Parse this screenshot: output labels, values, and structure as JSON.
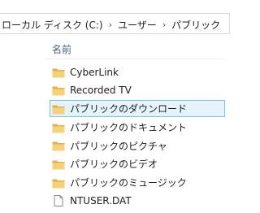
{
  "address_bar": {
    "crumbs": [
      {
        "label": "ローカル ディスク (C:)"
      },
      {
        "label": "ユーザー"
      },
      {
        "label": "パブリック"
      }
    ],
    "separator": "›"
  },
  "columns": {
    "name_header": "名前"
  },
  "files": [
    {
      "label": "CyberLink",
      "type": "folder"
    },
    {
      "label": "Recorded TV",
      "type": "folder"
    },
    {
      "label": "パブリックのダウンロード",
      "type": "folder",
      "selected": true
    },
    {
      "label": "パブリックのドキュメント",
      "type": "folder"
    },
    {
      "label": "パブリックのピクチャ",
      "type": "folder"
    },
    {
      "label": "パブリックのビデオ",
      "type": "folder"
    },
    {
      "label": "パブリックのミュージック",
      "type": "folder"
    },
    {
      "label": "NTUSER.DAT",
      "type": "file"
    }
  ],
  "colors": {
    "folder_fill": "#f5d27a",
    "folder_tab": "#e2b24a",
    "selection_bg": "#e5f3fb",
    "selection_border": "#7ac0ee",
    "header_text": "#4c607a"
  }
}
